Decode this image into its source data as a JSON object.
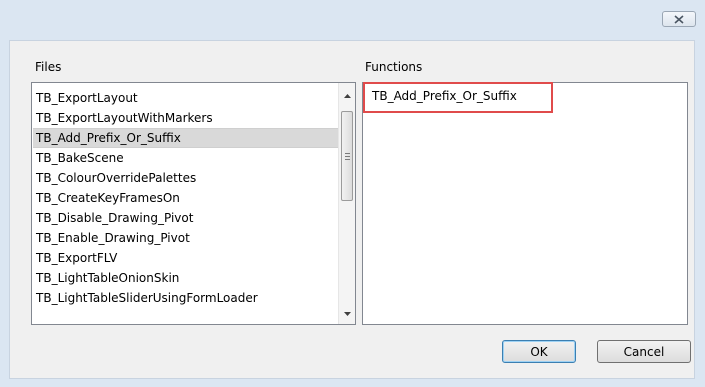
{
  "dialog": {
    "close_icon": "close-icon",
    "files_label": "Files",
    "functions_label": "Functions",
    "files": [
      "TB_ExportLayout",
      "TB_ExportLayoutWithMarkers",
      "TB_Add_Prefix_Or_Suffix",
      "TB_BakeScene",
      "TB_ColourOverridePalettes",
      "TB_CreateKeyFramesOn",
      "TB_Disable_Drawing_Pivot",
      "TB_Enable_Drawing_Pivot",
      "TB_ExportFLV",
      "TB_LightTableOnionSkin",
      "TB_LightTableSliderUsingFormLoader"
    ],
    "selected_file": "TB_Add_Prefix_Or_Suffix",
    "functions": [
      "TB_Add_Prefix_Or_Suffix"
    ],
    "ok_label": "OK",
    "cancel_label": "Cancel",
    "accent_color": "#e04b4b"
  }
}
